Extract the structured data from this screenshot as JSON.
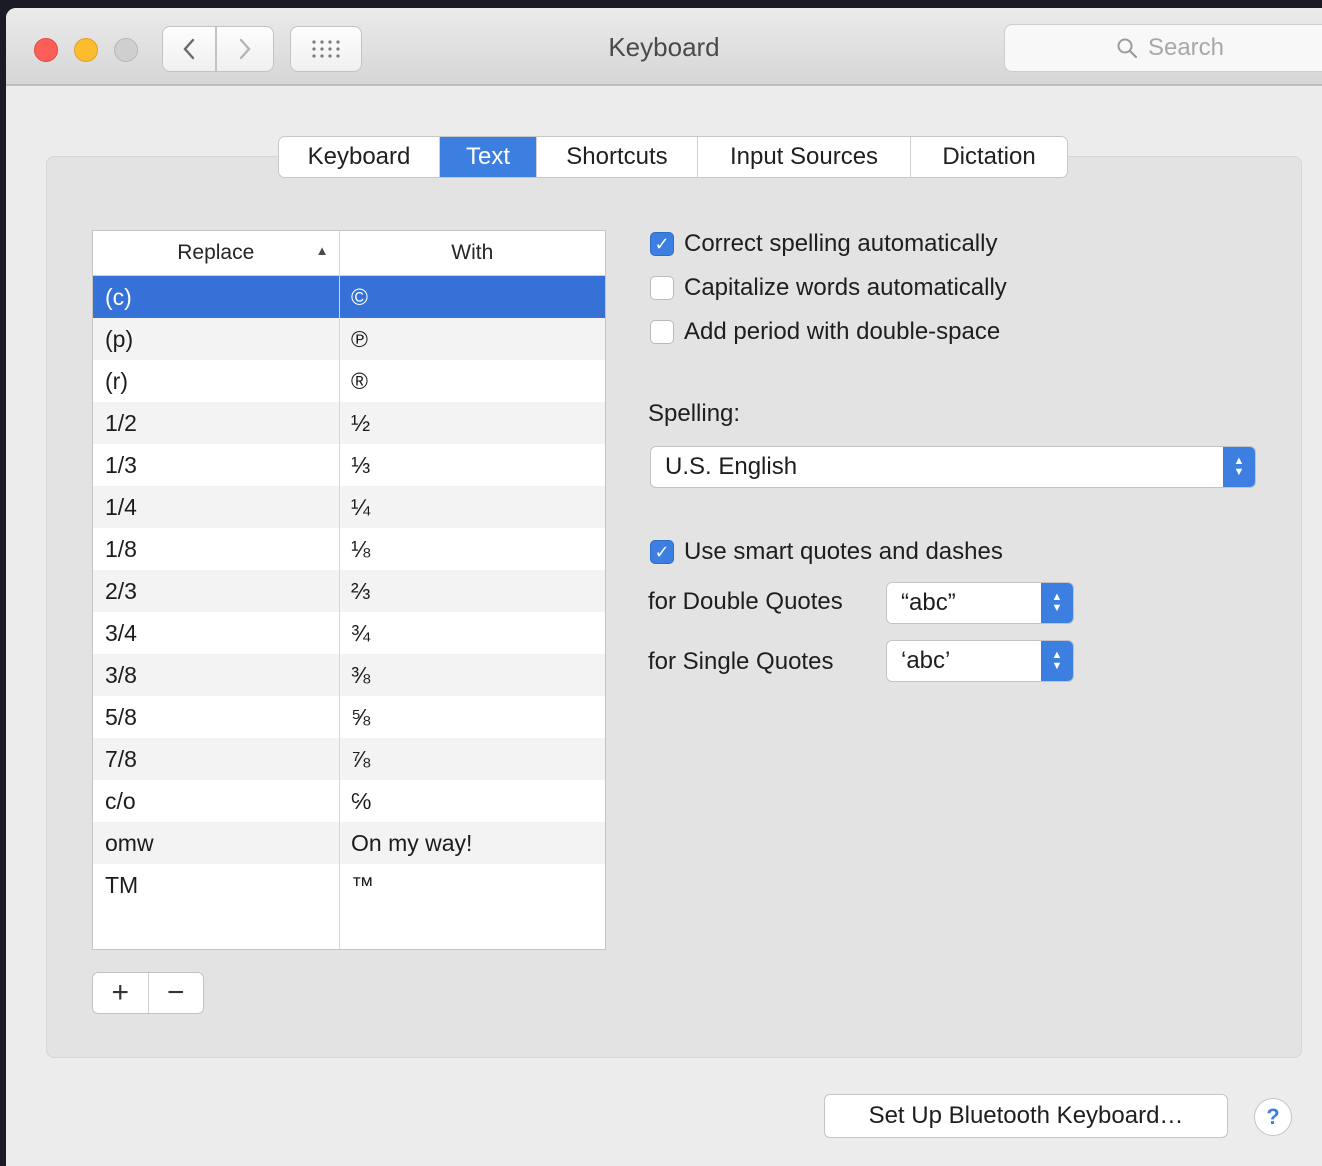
{
  "window": {
    "title": "Keyboard"
  },
  "toolbar": {
    "search_placeholder": "Search"
  },
  "tabs": [
    {
      "label": "Keyboard",
      "active": false
    },
    {
      "label": "Text",
      "active": true
    },
    {
      "label": "Shortcuts",
      "active": false
    },
    {
      "label": "Input Sources",
      "active": false
    },
    {
      "label": "Dictation",
      "active": false
    }
  ],
  "table": {
    "headers": {
      "replace": "Replace",
      "with": "With"
    },
    "rows": [
      {
        "replace": "(c)",
        "with": "©",
        "selected": true
      },
      {
        "replace": "(p)",
        "with": "℗"
      },
      {
        "replace": "(r)",
        "with": "®"
      },
      {
        "replace": "1/2",
        "with": "½"
      },
      {
        "replace": "1/3",
        "with": "⅓"
      },
      {
        "replace": "1/4",
        "with": "¼"
      },
      {
        "replace": "1/8",
        "with": "⅛"
      },
      {
        "replace": "2/3",
        "with": "⅔"
      },
      {
        "replace": "3/4",
        "with": "¾"
      },
      {
        "replace": "3/8",
        "with": "⅜"
      },
      {
        "replace": "5/8",
        "with": "⅝"
      },
      {
        "replace": "7/8",
        "with": "⅞"
      },
      {
        "replace": "c/o",
        "with": "℅"
      },
      {
        "replace": "omw",
        "with": "On my way!"
      },
      {
        "replace": "TM",
        "with": "™"
      }
    ]
  },
  "buttons": {
    "add": "+",
    "remove": "−",
    "bluetooth": "Set Up Bluetooth Keyboard…",
    "help": "?"
  },
  "options": {
    "correct_spelling": {
      "label": "Correct spelling automatically",
      "checked": true
    },
    "capitalize": {
      "label": "Capitalize words automatically",
      "checked": false
    },
    "add_period": {
      "label": "Add period with double-space",
      "checked": false
    },
    "spelling_label": "Spelling:",
    "spelling_value": "U.S. English",
    "smart_quotes": {
      "label": "Use smart quotes and dashes",
      "checked": true
    },
    "double_quotes_label": "for Double Quotes",
    "double_quotes_value": "“abc”",
    "single_quotes_label": "for Single Quotes",
    "single_quotes_value": "‘abc’"
  },
  "colors": {
    "accent": "#3d7fe0",
    "selection": "#3571d6"
  }
}
